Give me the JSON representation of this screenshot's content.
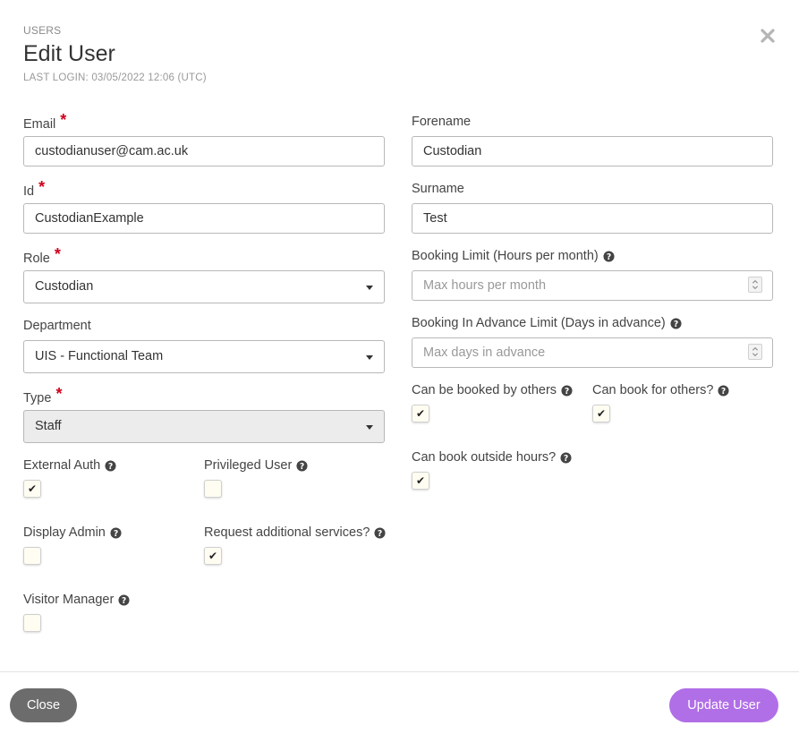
{
  "header": {
    "breadcrumb": "USERS",
    "title": "Edit User",
    "last_login": "LAST LOGIN: 03/05/2022 12:06 (UTC)"
  },
  "fields": {
    "email": {
      "label": "Email",
      "value": "custodianuser@cam.ac.uk"
    },
    "id": {
      "label": "Id",
      "value": "CustodianExample"
    },
    "role": {
      "label": "Role",
      "value": "Custodian"
    },
    "department": {
      "label": "Department",
      "value": "UIS - Functional Team"
    },
    "type": {
      "label": "Type",
      "value": "Staff"
    },
    "forename": {
      "label": "Forename",
      "value": "Custodian"
    },
    "surname": {
      "label": "Surname",
      "value": "Test"
    },
    "booking_limit": {
      "label": "Booking Limit (Hours per month)",
      "placeholder": "Max hours per month"
    },
    "advance_limit": {
      "label": "Booking In Advance Limit (Days in advance)",
      "placeholder": "Max days in advance"
    }
  },
  "required_marker": "*",
  "checkboxes": {
    "external_auth": {
      "label": "External Auth",
      "checked": true
    },
    "privileged_user": {
      "label": "Privileged User",
      "checked": false
    },
    "display_admin": {
      "label": "Display Admin",
      "checked": false
    },
    "request_services": {
      "label": "Request additional services?",
      "checked": true
    },
    "visitor_manager": {
      "label": "Visitor Manager",
      "checked": false
    },
    "booked_by_others": {
      "label": "Can be booked by others",
      "checked": true
    },
    "book_for_others": {
      "label": "Can book for others?",
      "checked": true
    },
    "outside_hours": {
      "label": "Can book outside hours?",
      "checked": true
    }
  },
  "check_glyph": "✔",
  "footer": {
    "close_label": "Close",
    "update_label": "Update User"
  },
  "colors": {
    "primary": "#b06fe6",
    "secondary": "#6c6c6c",
    "required": "#d0021b"
  },
  "icons": {
    "close": "close-icon",
    "help": "question-circle-icon",
    "dropdown": "caret-down-icon"
  }
}
